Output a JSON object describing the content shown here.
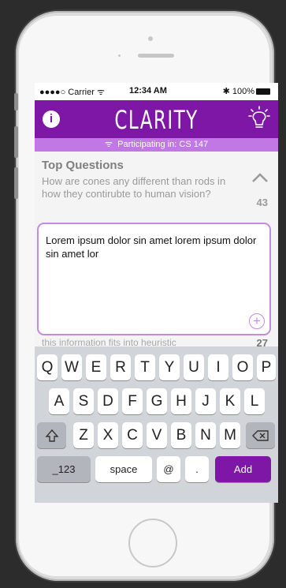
{
  "status_bar": {
    "carrier": "●●●●○ Carrier",
    "time": "12:34 AM",
    "battery": "100%"
  },
  "app": {
    "title": "CLARITY",
    "participating": "Participating in: CS 147"
  },
  "questions": {
    "header": "Top Questions",
    "items": [
      {
        "text": "How are cones any different than rods in how they contirubte to human vision?",
        "votes": "43"
      },
      {
        "text": "this information fits into heuristic",
        "votes": "27"
      }
    ]
  },
  "compose": {
    "text": "Lorem ipsum dolor sin amet lorem ipsum dolor sin amet lor"
  },
  "keyboard": {
    "row1": [
      "Q",
      "W",
      "E",
      "R",
      "T",
      "Y",
      "U",
      "I",
      "O",
      "P"
    ],
    "row2": [
      "A",
      "S",
      "D",
      "F",
      "G",
      "H",
      "J",
      "K",
      "L"
    ],
    "row3": [
      "Z",
      "X",
      "C",
      "V",
      "B",
      "N",
      "M"
    ],
    "numbers_label": "_123",
    "space_label": "space",
    "at_label": "@",
    "dot_label": ".",
    "add_label": "Add"
  },
  "colors": {
    "primary": "#7e16a6",
    "accent": "#c178e5"
  }
}
